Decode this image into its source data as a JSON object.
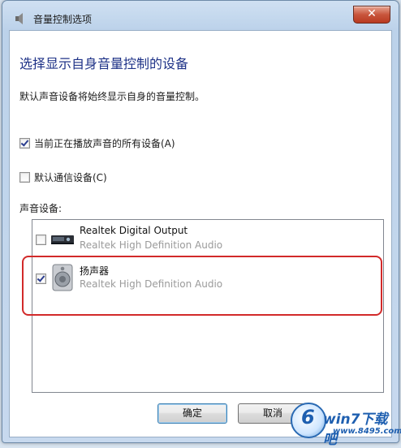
{
  "window": {
    "title": "音量控制选项",
    "close_glyph": "✕"
  },
  "dialog": {
    "heading": "选择显示自身音量控制的设备",
    "description": "默认声音设备将始终显示自身的音量控制。",
    "options": [
      {
        "label": "当前正在播放声音的所有设备(A)",
        "checked": true
      },
      {
        "label": "默认通信设备(C)",
        "checked": false
      }
    ],
    "devices_label": "声音设备:",
    "devices": [
      {
        "name": "Realtek Digital Output",
        "driver": "Realtek High Definition Audio",
        "checked": false,
        "icon": "digital-output-icon"
      },
      {
        "name": "扬声器",
        "driver": "Realtek High Definition Audio",
        "checked": true,
        "icon": "speaker-icon"
      }
    ],
    "ok_label": "确定",
    "cancel_label": "取消"
  },
  "watermark": {
    "brand": "win7下载吧",
    "url": "www.8495.com"
  },
  "colors": {
    "heading": "#1e3287",
    "highlight": "#d22a2a"
  }
}
